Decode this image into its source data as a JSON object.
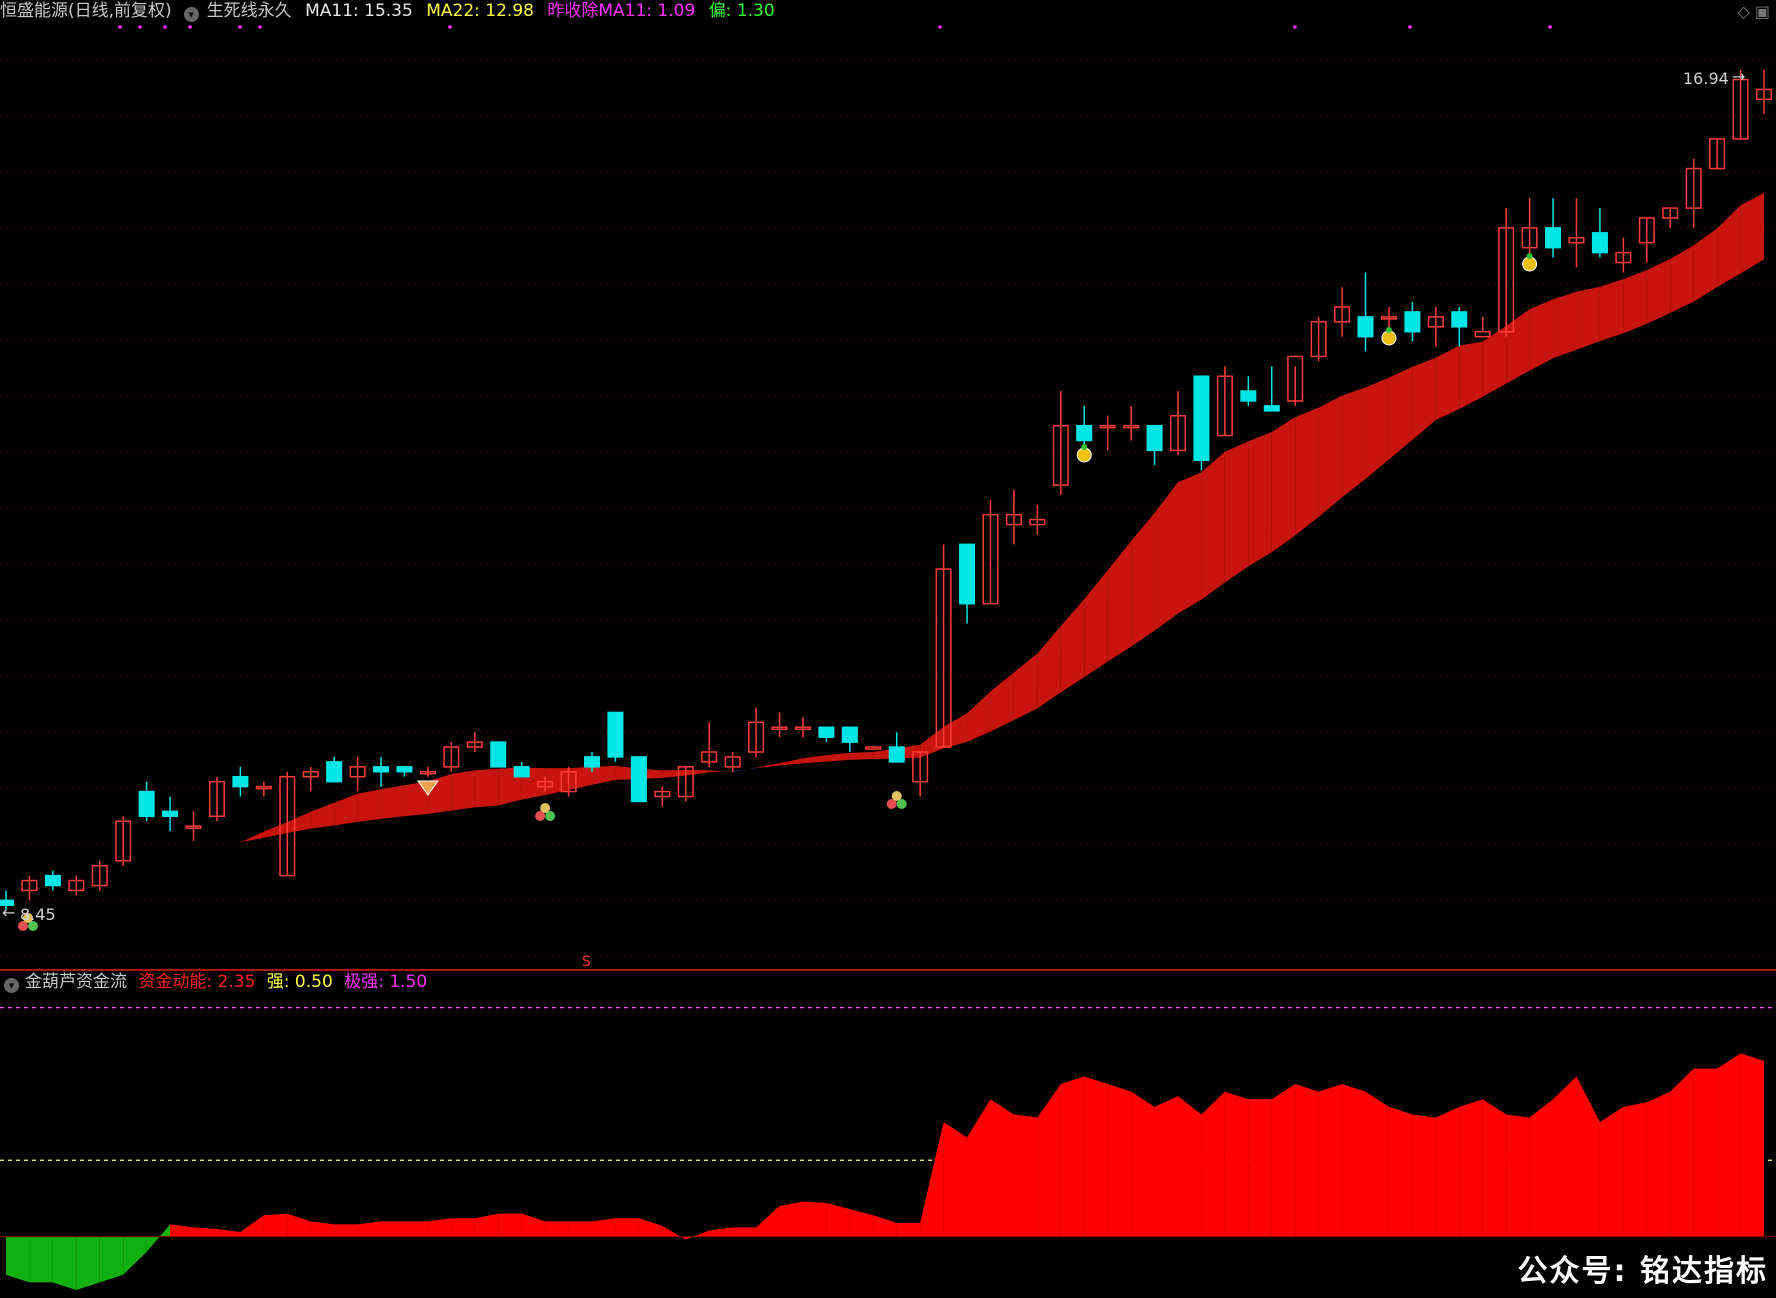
{
  "header": {
    "stock": "恒盛能源(日线,前复权)",
    "indicator": "生死线永久",
    "ma11": "MA11: 15.35",
    "ma22": "MA22: 12.98",
    "ratio": "昨收除MA11: 1.09",
    "dev": "偏: 1.30",
    "colors": {
      "stock": "#c8c8c8",
      "ma11": "#e8e8e8",
      "ma22": "#ffff40",
      "ratio": "#ff30ff",
      "dev": "#30ff30"
    }
  },
  "main_chart": {
    "high_label": "16.94",
    "low_label": "8.45",
    "s_marker": "S",
    "ribbon_colors": {
      "bear": "#1e6bd6",
      "bull": "#c8140e"
    },
    "candle_colors": {
      "up": "#ff3b3b",
      "down": "#00e5e5"
    }
  },
  "sub_header": {
    "name": "金葫芦资金流",
    "power": "资金动能: 2.35",
    "strong": "强: 0.50",
    "extreme": "极强: 1.50",
    "colors": {
      "power": "#ff2020",
      "strong": "#ffff40",
      "extreme": "#ff30ff"
    }
  },
  "watermark": "公众号: 铭达指标",
  "top_right_icons": [
    "diamond-icon",
    "window-icon"
  ],
  "chart_data": [
    {
      "type": "candlestick",
      "candles": [
        [
          8.6,
          8.7,
          8.5,
          8.55
        ],
        [
          8.7,
          8.85,
          8.6,
          8.8
        ],
        [
          8.85,
          8.9,
          8.7,
          8.75
        ],
        [
          8.7,
          8.85,
          8.65,
          8.8
        ],
        [
          8.75,
          9.0,
          8.7,
          8.95
        ],
        [
          9.0,
          9.45,
          8.95,
          9.4
        ],
        [
          9.7,
          9.8,
          9.4,
          9.45
        ],
        [
          9.5,
          9.65,
          9.3,
          9.45
        ],
        [
          9.35,
          9.5,
          9.2,
          9.35
        ],
        [
          9.45,
          9.85,
          9.4,
          9.8
        ],
        [
          9.85,
          9.95,
          9.65,
          9.75
        ],
        [
          9.75,
          9.8,
          9.65,
          9.75
        ],
        [
          8.85,
          9.9,
          8.85,
          9.85
        ],
        [
          9.85,
          9.95,
          9.7,
          9.9
        ],
        [
          10.0,
          10.05,
          9.8,
          9.8
        ],
        [
          9.85,
          10.05,
          9.7,
          9.95
        ],
        [
          9.95,
          10.05,
          9.75,
          9.9
        ],
        [
          9.95,
          9.95,
          9.85,
          9.9
        ],
        [
          9.9,
          9.95,
          9.85,
          9.9
        ],
        [
          9.95,
          10.2,
          9.9,
          10.15
        ],
        [
          10.15,
          10.3,
          10.1,
          10.2
        ],
        [
          10.2,
          10.2,
          9.95,
          9.95
        ],
        [
          9.95,
          10.0,
          9.85,
          9.85
        ],
        [
          9.75,
          9.85,
          9.7,
          9.8
        ],
        [
          9.7,
          9.95,
          9.65,
          9.9
        ],
        [
          10.05,
          10.1,
          9.9,
          9.95
        ],
        [
          10.5,
          10.5,
          10.0,
          10.05
        ],
        [
          10.05,
          10.05,
          9.6,
          9.6
        ],
        [
          9.65,
          9.75,
          9.55,
          9.7
        ],
        [
          9.65,
          9.95,
          9.6,
          9.95
        ],
        [
          10.0,
          10.4,
          9.95,
          10.1
        ],
        [
          9.95,
          10.1,
          9.9,
          10.05
        ],
        [
          10.1,
          10.55,
          10.05,
          10.4
        ],
        [
          10.35,
          10.5,
          10.25,
          10.35
        ],
        [
          10.35,
          10.45,
          10.25,
          10.35
        ],
        [
          10.35,
          10.35,
          10.2,
          10.25
        ],
        [
          10.35,
          10.35,
          10.1,
          10.2
        ],
        [
          10.15,
          10.15,
          10.15,
          10.15
        ],
        [
          10.15,
          10.3,
          10.0,
          10.0
        ],
        [
          9.8,
          10.1,
          9.65,
          10.1
        ],
        [
          10.15,
          12.2,
          10.15,
          11.95
        ],
        [
          12.2,
          12.2,
          11.4,
          11.6
        ],
        [
          11.6,
          12.65,
          11.6,
          12.5
        ],
        [
          12.4,
          12.75,
          12.2,
          12.5
        ],
        [
          12.4,
          12.6,
          12.3,
          12.45
        ],
        [
          12.8,
          13.75,
          12.7,
          13.4
        ],
        [
          13.4,
          13.6,
          13.05,
          13.25
        ],
        [
          13.4,
          13.5,
          13.15,
          13.4
        ],
        [
          13.4,
          13.6,
          13.25,
          13.4
        ],
        [
          13.4,
          13.4,
          13.0,
          13.15
        ],
        [
          13.15,
          13.75,
          13.1,
          13.5
        ],
        [
          13.9,
          13.9,
          12.95,
          13.05
        ],
        [
          13.3,
          14.0,
          13.3,
          13.9
        ],
        [
          13.75,
          13.9,
          13.6,
          13.65
        ],
        [
          13.6,
          14.0,
          13.55,
          13.55
        ],
        [
          13.65,
          14.0,
          13.6,
          14.1
        ],
        [
          14.1,
          14.5,
          14.05,
          14.45
        ],
        [
          14.45,
          14.8,
          14.3,
          14.6
        ],
        [
          14.5,
          14.95,
          14.15,
          14.3
        ],
        [
          14.5,
          14.6,
          14.3,
          14.5
        ],
        [
          14.55,
          14.65,
          14.25,
          14.35
        ],
        [
          14.4,
          14.6,
          14.2,
          14.5
        ],
        [
          14.55,
          14.6,
          14.2,
          14.4
        ],
        [
          14.3,
          14.5,
          14.35,
          14.35
        ],
        [
          14.35,
          15.6,
          14.3,
          15.4
        ],
        [
          15.2,
          15.7,
          15.0,
          15.4
        ],
        [
          15.4,
          15.7,
          15.1,
          15.2
        ],
        [
          15.25,
          15.7,
          15.0,
          15.3
        ],
        [
          15.35,
          15.6,
          15.1,
          15.15
        ],
        [
          15.05,
          15.3,
          14.95,
          15.15
        ],
        [
          15.25,
          15.5,
          15.05,
          15.5
        ],
        [
          15.5,
          15.6,
          15.4,
          15.6
        ],
        [
          15.6,
          16.1,
          15.4,
          16.0
        ],
        [
          16.0,
          16.3,
          16.0,
          16.3
        ],
        [
          16.3,
          17.0,
          16.3,
          16.9
        ],
        [
          16.7,
          17.0,
          16.55,
          16.8
        ]
      ],
      "ylim": [
        8.3,
        17.3
      ]
    },
    {
      "type": "area",
      "name": "资金动能",
      "values": [
        -0.25,
        -0.3,
        -0.3,
        -0.35,
        -0.3,
        -0.25,
        -0.1,
        0.08,
        0.06,
        0.05,
        0.03,
        0.14,
        0.15,
        0.1,
        0.08,
        0.08,
        0.1,
        0.1,
        0.1,
        0.12,
        0.12,
        0.15,
        0.15,
        0.1,
        0.1,
        0.1,
        0.12,
        0.12,
        0.07,
        -0.02,
        0.04,
        0.06,
        0.06,
        0.2,
        0.23,
        0.22,
        0.18,
        0.14,
        0.09,
        0.09,
        0.75,
        0.65,
        0.9,
        0.8,
        0.78,
        1.0,
        1.05,
        1.0,
        0.95,
        0.85,
        0.92,
        0.8,
        0.95,
        0.9,
        0.9,
        1.0,
        0.95,
        1.0,
        0.95,
        0.85,
        0.8,
        0.78,
        0.85,
        0.9,
        0.8,
        0.78,
        0.9,
        1.05,
        0.75,
        0.85,
        0.88,
        0.95,
        1.1,
        1.1,
        1.2,
        1.15
      ],
      "ref_lines": [
        0.5,
        1.5
      ],
      "ylim": [
        -0.35,
        1.55
      ]
    }
  ]
}
